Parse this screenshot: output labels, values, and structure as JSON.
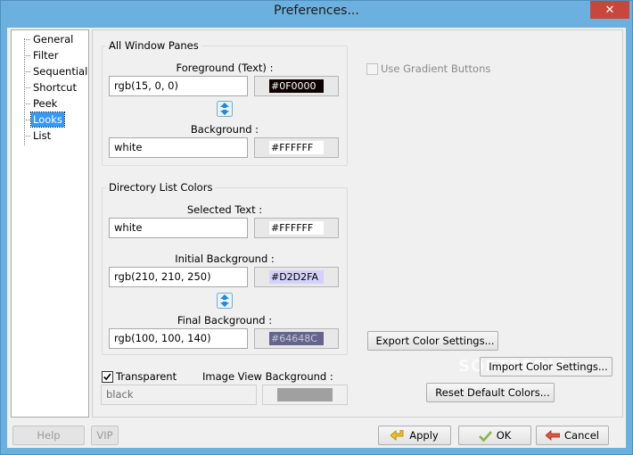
{
  "window": {
    "title": "Preferences...",
    "close_glyph": "✕",
    "accent": "#6cb0df",
    "close_color": "#c9463d"
  },
  "tree": {
    "items": [
      {
        "label": "General"
      },
      {
        "label": "Filter"
      },
      {
        "label": "Sequential"
      },
      {
        "label": "Shortcut"
      },
      {
        "label": "Peek"
      },
      {
        "label": "Looks"
      },
      {
        "label": "List"
      }
    ],
    "selected": "Looks"
  },
  "all_panes": {
    "title": "All Window Panes",
    "foreground_label": "Foreground (Text) :",
    "foreground_value": "rgb(15, 0, 0)",
    "foreground_swatch": {
      "hex": "#0F0000",
      "color": "#0f0000",
      "text_color": "#ffffff"
    },
    "background_label": "Background :",
    "background_value": "white",
    "background_swatch": {
      "hex": "#FFFFFF",
      "color": "#ffffff",
      "text_color": "#000000"
    }
  },
  "gradient": {
    "label": "Use Gradient Buttons",
    "checked": false,
    "enabled": false
  },
  "dir_colors": {
    "title": "Directory List Colors",
    "selected_label": "Selected Text :",
    "selected_value": "white",
    "selected_swatch": {
      "hex": "#FFFFFF",
      "color": "#ffffff",
      "text_color": "#000000"
    },
    "initial_label": "Initial Background :",
    "initial_value": "rgb(210, 210, 250)",
    "initial_swatch": {
      "hex": "#D2D2FA",
      "color": "#d2d2fa",
      "text_color": "#000000"
    },
    "final_label": "Final Background :",
    "final_value": "rgb(100, 100, 140)",
    "final_swatch": {
      "hex": "#64648C",
      "color": "#64648c",
      "text_color": "#c8c8d8"
    }
  },
  "image_view": {
    "transparent_label": "Transparent",
    "transparent_checked": true,
    "bg_label": "Image View Background :",
    "bg_value": "black",
    "bg_swatch_color": "#a0a0a0"
  },
  "actions": {
    "export_label": "Export Color Settings...",
    "import_label": "Import Color Settings...",
    "reset_label": "Reset Default Colors..."
  },
  "footer": {
    "help_label": "Help",
    "vip_label": "VIP",
    "apply_label": "Apply",
    "ok_label": "OK",
    "cancel_label": "Cancel"
  },
  "watermark": "SOFTPEDIA"
}
